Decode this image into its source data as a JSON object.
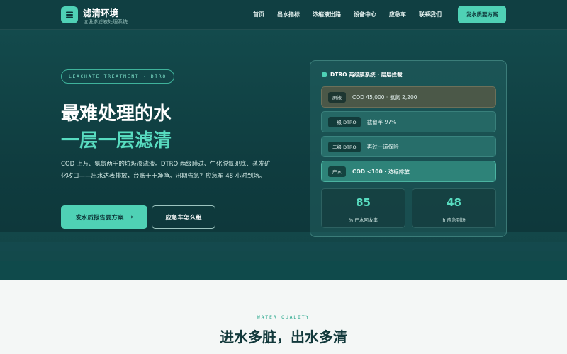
{
  "nav": {
    "brand_name": "滤清环境",
    "brand_sub": "垃圾渗滤液处理系统",
    "links": [
      "首页",
      "出水指标",
      "浓缩液出路",
      "设备中心",
      "应急车",
      "联系我们"
    ],
    "cta": "发水质要方案"
  },
  "hero": {
    "tag": "LEACHATE TREATMENT · DTRO",
    "title_line1": "最难处理的水",
    "title_line2": "一层一层滤清",
    "description": "COD 上万、氨氮两千的垃圾渗滤液。DTRO 两级膜过、生化脱氮兜底、蒸发矿化收口——出水达表排放，台账干干净净。汛期告急？应急车 48 小时到场。",
    "primary_button": "发水质报告要方案",
    "primary_arrow": "→",
    "secondary_button": "应急车怎么租"
  },
  "panel": {
    "title": "DTRO 两级膜系统 · 层层拦截",
    "stages": [
      {
        "chip": "原液",
        "text": "COD 45,000 · 氨氮 2,200"
      },
      {
        "chip": "一级 DTRO",
        "text": "截留率 97%"
      },
      {
        "chip": "二级 DTRO",
        "text": "再过一道保险"
      },
      {
        "chip": "产水",
        "text": "COD <100 · 达标排放"
      }
    ],
    "stats": [
      {
        "value": "85",
        "label": "% 产水回收率"
      },
      {
        "value": "48",
        "label": "h 应急到场"
      }
    ]
  },
  "section": {
    "eyebrow": "WATER QUALITY",
    "title": "进水多脏，出水多清"
  },
  "colors": {
    "accent": "#4fd1b5",
    "accent_text": "#58dcc0",
    "hero_bg": "#0f3c3f",
    "section_bg": "#f4f7f6"
  }
}
